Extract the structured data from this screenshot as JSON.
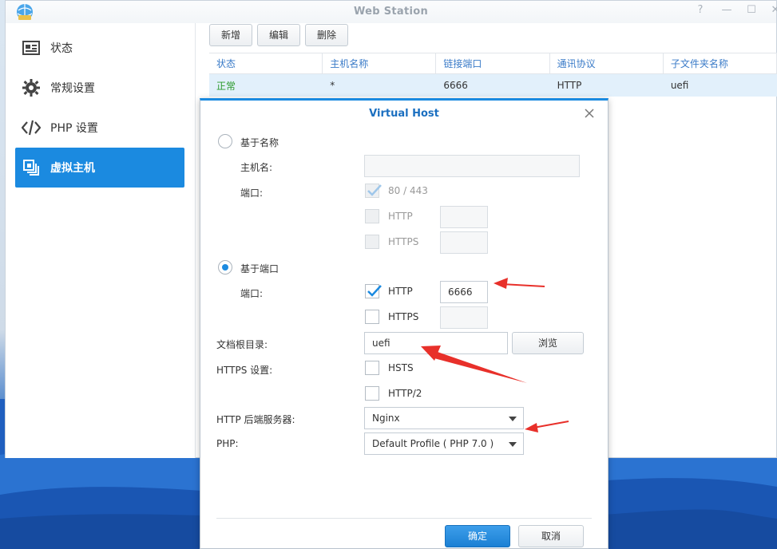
{
  "window": {
    "title": "Web Station",
    "help_glyph": "?",
    "min_glyph": "—",
    "max_glyph": "☐",
    "close_glyph": "✕"
  },
  "sidebar": {
    "items": [
      {
        "label": "状态",
        "icon": "status-icon"
      },
      {
        "label": "常规设置",
        "icon": "gear-icon"
      },
      {
        "label": "PHP 设置",
        "icon": "code-icon"
      },
      {
        "label": "虚拟主机",
        "icon": "virtual-host-icon",
        "active": true
      }
    ]
  },
  "toolbar": {
    "add_label": "新增",
    "edit_label": "编辑",
    "delete_label": "删除"
  },
  "table": {
    "columns": [
      "状态",
      "主机名称",
      "链接端口",
      "通讯协议",
      "子文件夹名称"
    ],
    "rows": [
      {
        "status": "正常",
        "hostname": "*",
        "port": "6666",
        "protocol": "HTTP",
        "folder": "uefi"
      }
    ]
  },
  "dialog": {
    "title": "Virtual Host",
    "by_name_label": "基于名称",
    "hostname_label": "主机名:",
    "hostname_value": "",
    "port_label": "端口:",
    "default_ports_label": "80 / 443",
    "http_label": "HTTP",
    "https_label": "HTTPS",
    "by_port_label": "基于端口",
    "port2_label": "端口:",
    "http_port_value": "6666",
    "https_port_value": "",
    "doc_root_label": "文档根目录:",
    "doc_root_value": "uefi",
    "browse_label": "浏览",
    "https_settings_label": "HTTPS 设置:",
    "hsts_label": "HSTS",
    "http2_label": "HTTP/2",
    "backend_label": "HTTP 后端服务器:",
    "backend_value": "Nginx",
    "php_label": "PHP:",
    "php_value": "Default Profile ( PHP 7.0 )",
    "ok_label": "确定",
    "cancel_label": "取消"
  },
  "colors": {
    "accent": "#1b8ae0",
    "annotation": "#e8302a",
    "status_ok": "#2c9a2c"
  }
}
